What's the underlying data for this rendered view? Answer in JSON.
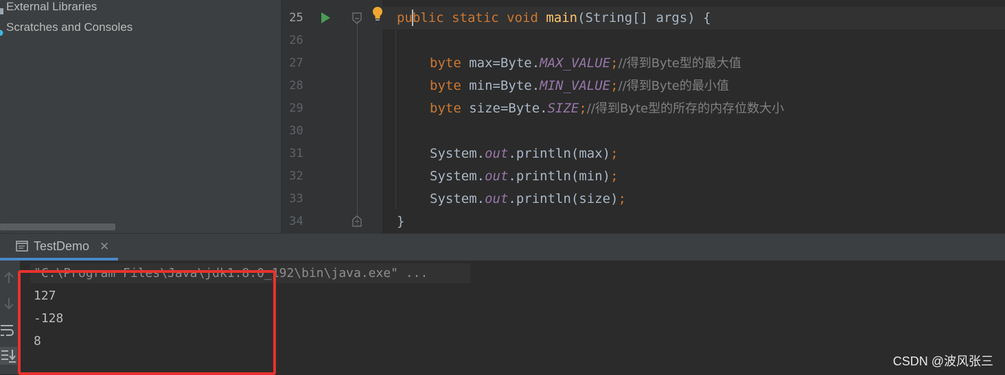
{
  "project_tree": {
    "items": [
      {
        "label": "External Libraries",
        "icon": "library-icon"
      },
      {
        "label": "Scratches and Consoles",
        "icon": "scratches-icon"
      }
    ]
  },
  "editor": {
    "current_line": "25",
    "lines": [
      {
        "num": "25"
      },
      {
        "num": "26"
      },
      {
        "num": "27"
      },
      {
        "num": "28"
      },
      {
        "num": "29"
      },
      {
        "num": "30"
      },
      {
        "num": "31"
      },
      {
        "num": "32"
      },
      {
        "num": "33"
      },
      {
        "num": "34"
      }
    ],
    "code": {
      "l25": {
        "kw": "public static void ",
        "fn": "main",
        "rest": "(String[] args) {"
      },
      "l27": {
        "kw": "byte ",
        "a": "max=Byte.",
        "st": "MAX_VALUE",
        "semi": ";",
        "cm": "//得到Byte型的最大值"
      },
      "l28": {
        "kw": "byte ",
        "a": "min=Byte.",
        "st": "MIN_VALUE",
        "semi": ";",
        "cm": "//得到Byte的最小值"
      },
      "l29": {
        "kw": "byte ",
        "a": "size=Byte.",
        "st": "SIZE",
        "semi": ";",
        "cm": "//得到Byte型的所存的内存位数大小"
      },
      "l31": {
        "a": "System.",
        "st": "out",
        "b": ".println(max)",
        "semi": ";"
      },
      "l32": {
        "a": "System.",
        "st": "out",
        "b": ".println(min)",
        "semi": ";"
      },
      "l33": {
        "a": "System.",
        "st": "out",
        "b": ".println(size)",
        "semi": ";"
      },
      "l34": {
        "a": "}"
      }
    }
  },
  "run_window": {
    "tab_label": "TestDemo",
    "command": "\"C:\\Program Files\\Java\\jdk1.8.0_192\\bin\\java.exe\" ...",
    "output": [
      "127",
      "-128",
      "8"
    ]
  },
  "watermark": "CSDN @波风张三",
  "colors": {
    "keyword": "#cc7832",
    "function": "#ffc66d",
    "static_field": "#9876aa",
    "comment": "#808080",
    "highlight_box": "#e8322c",
    "run_icon": "#499c54"
  }
}
